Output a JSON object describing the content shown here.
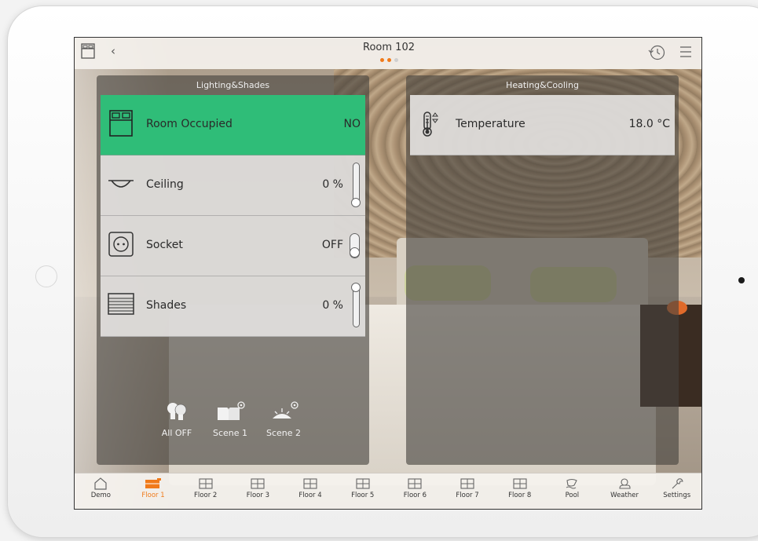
{
  "header": {
    "title": "Room 102",
    "back_glyph": "‹",
    "page_dots": [
      "#f07a1a",
      "#f07a1a",
      "#cfcfcf"
    ]
  },
  "lighting": {
    "title": "Lighting&Shades",
    "rows": [
      {
        "label": "Room Occupied",
        "value": "NO",
        "icon": "bed-icon",
        "active": true
      },
      {
        "label": "Ceiling",
        "value": "0 %",
        "icon": "ceiling-lamp-icon",
        "level": 0
      },
      {
        "label": "Socket",
        "value": "OFF",
        "icon": "socket-icon",
        "state": "off"
      },
      {
        "label": "Shades",
        "value": "0 %",
        "icon": "shades-icon",
        "level": 0
      }
    ],
    "scenes": [
      {
        "label": "All OFF",
        "icon": "bulbs-icon"
      },
      {
        "label": "Scene 1",
        "icon": "book-scene-icon"
      },
      {
        "label": "Scene 2",
        "icon": "sunrise-scene-icon"
      }
    ]
  },
  "heating": {
    "title": "Heating&Cooling",
    "rows": [
      {
        "label": "Temperature",
        "value": "18.0 °C",
        "icon": "thermometer-icon"
      }
    ]
  },
  "nav": {
    "items": [
      {
        "label": "Demo",
        "icon": "house-icon"
      },
      {
        "label": "Floor 1",
        "icon": "floor-plan-icon",
        "active": true
      },
      {
        "label": "Floor 2",
        "icon": "floor-plan-icon"
      },
      {
        "label": "Floor 3",
        "icon": "floor-plan-icon"
      },
      {
        "label": "Floor 4",
        "icon": "floor-plan-icon"
      },
      {
        "label": "Floor 5",
        "icon": "floor-plan-icon"
      },
      {
        "label": "Floor 6",
        "icon": "floor-plan-icon"
      },
      {
        "label": "Floor 7",
        "icon": "floor-plan-icon"
      },
      {
        "label": "Floor 8",
        "icon": "floor-plan-icon"
      },
      {
        "label": "Pool",
        "icon": "pool-icon"
      },
      {
        "label": "Weather",
        "icon": "weather-icon"
      },
      {
        "label": "Settings",
        "icon": "wrench-icon"
      }
    ]
  },
  "colors": {
    "accent": "#f07a1a",
    "occupied_green": "#2fbd78"
  }
}
